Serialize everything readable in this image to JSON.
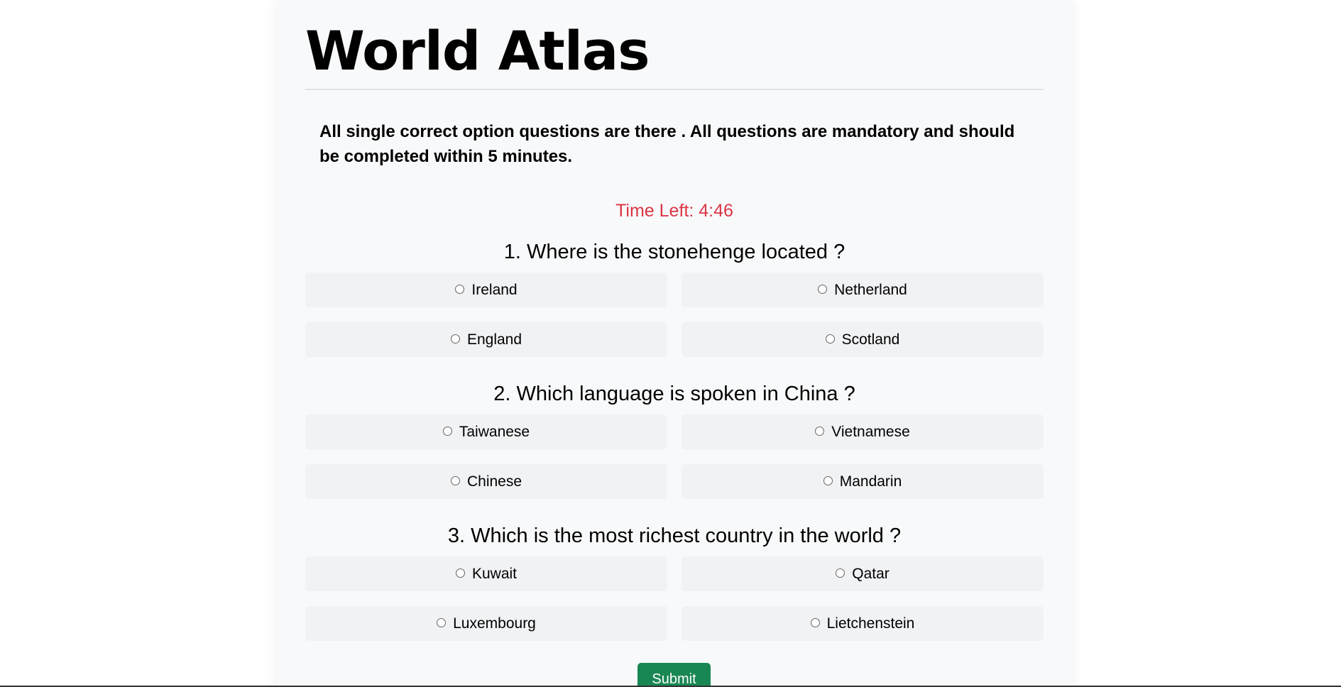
{
  "header": {
    "title": "World Atlas"
  },
  "instructions": "All single correct option questions are there . All questions are mandatory and should be completed within 5 minutes.",
  "timer": {
    "label": "Time Left: 4:46"
  },
  "questions": [
    {
      "text": "1. Where is the stonehenge located ?",
      "options": [
        "Ireland",
        "Netherland",
        "England",
        "Scotland"
      ]
    },
    {
      "text": "2. Which language is spoken in China ?",
      "options": [
        "Taiwanese",
        "Vietnamese",
        "Chinese",
        "Mandarin"
      ]
    },
    {
      "text": "3. Which is the most richest country in the world ?",
      "options": [
        "Kuwait",
        "Qatar",
        "Luxembourg",
        "Lietchenstein"
      ]
    }
  ],
  "form": {
    "submit_label": "Submit"
  },
  "colors": {
    "timer": "#dc3545",
    "submit": "#198754",
    "card_background": "#f8f9fa",
    "option_background": "#f1f2f4"
  }
}
